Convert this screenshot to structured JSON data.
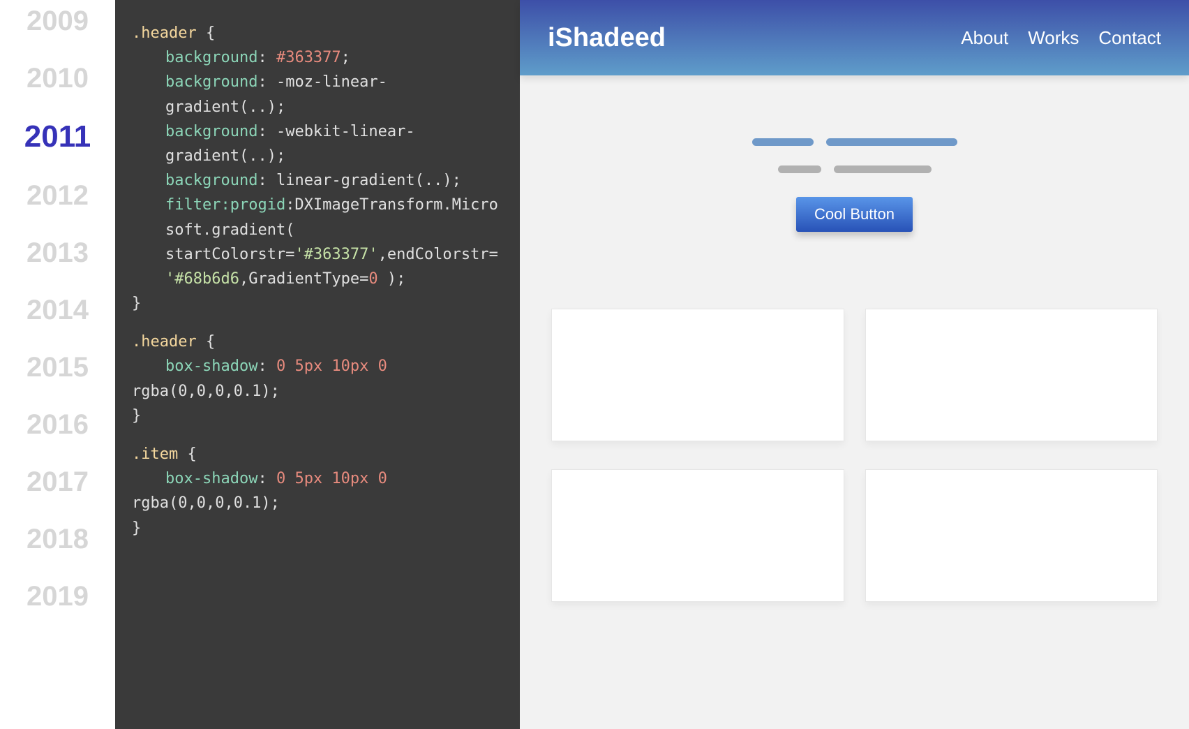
{
  "years": [
    "2009",
    "2010",
    "2011",
    "2012",
    "2013",
    "2014",
    "2015",
    "2016",
    "2017",
    "2018",
    "2019"
  ],
  "activeYearIndex": 2,
  "code": {
    "block1": {
      "selector": ".header",
      "lines": [
        {
          "prop": "background",
          "raw": "#363377",
          "type": "hex"
        },
        {
          "prop": "background",
          "raw": "-moz-linear-gradient(..)",
          "type": "func"
        },
        {
          "prop": "background",
          "raw": "-webkit-linear-gradient(..)",
          "type": "func"
        },
        {
          "prop": "background",
          "raw": "linear-gradient(..)",
          "type": "func"
        }
      ],
      "filterLine": {
        "prefix": "filter:progid",
        "mid": ":DXImageTransform.Microsoft.gradient( startColorstr=",
        "color1": "'#363377'",
        "between": ",endColorstr=",
        "color2": "'#68b6d6",
        "tail": ",GradientType=",
        "zero": "0",
        "end": " );"
      }
    },
    "block2": {
      "selector": ".header",
      "prop": "box-shadow",
      "nums": "0 5px 10px 0",
      "tail": "rgba(0,0,0,0.1);"
    },
    "block3": {
      "selector": ".item",
      "prop": "box-shadow",
      "nums": "0 5px 10px 0",
      "tail": "rgba(0,0,0,0.1);"
    }
  },
  "preview": {
    "logo": "iShadeed",
    "nav": [
      "About",
      "Works",
      "Contact"
    ],
    "button": "Cool Button"
  }
}
